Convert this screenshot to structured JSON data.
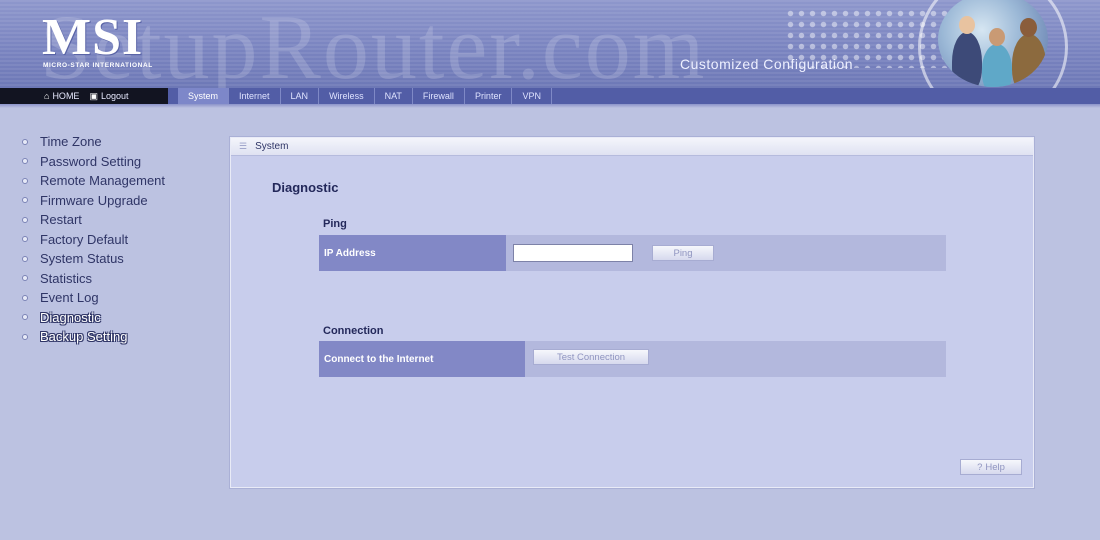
{
  "header": {
    "watermark": "SetupRouter.com",
    "logo": "MSI",
    "logo_sub": "MICRO-STAR INTERNATIONAL",
    "tagline": "Customized Configuration"
  },
  "nav": {
    "home": "HOME",
    "logout": "Logout",
    "tabs": [
      "System",
      "Internet",
      "LAN",
      "Wireless",
      "NAT",
      "Firewall",
      "Printer",
      "VPN"
    ],
    "active_tab": "System"
  },
  "sidebar": {
    "items": [
      "Time Zone",
      "Password Setting",
      "Remote Management",
      "Firmware Upgrade",
      "Restart",
      "Factory Default",
      "System Status",
      "Statistics",
      "Event Log",
      "Diagnostic",
      "Backup Setting"
    ],
    "current": "Diagnostic"
  },
  "panel": {
    "header": "System",
    "title": "Diagnostic",
    "ping": {
      "section": "Ping",
      "label": "IP Address",
      "value": "",
      "button": "Ping"
    },
    "connection": {
      "section": "Connection",
      "label": "Connect to the Internet",
      "button": "Test Connection"
    },
    "help_button": "Help"
  },
  "colors": {
    "page_bg": "#bcc2e1",
    "nav_bar": "#525da6",
    "row_label": "#8288c6"
  }
}
